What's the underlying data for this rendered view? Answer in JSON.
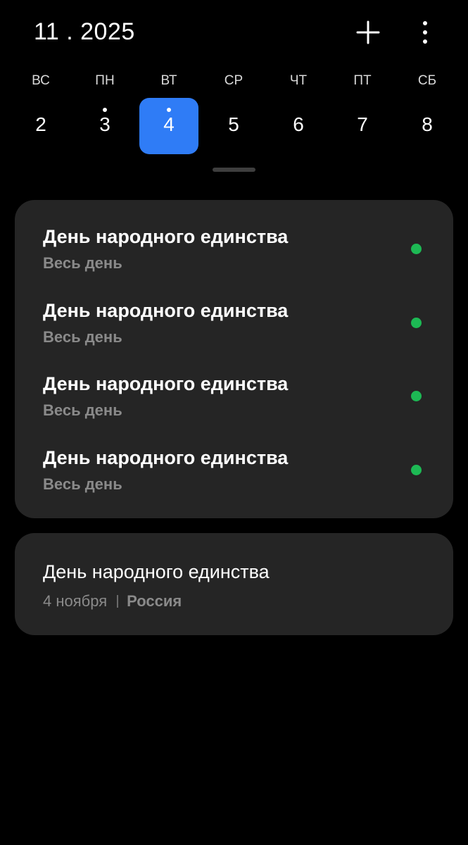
{
  "header": {
    "month_title": "11 . 2025",
    "add_icon": "plus-icon",
    "more_icon": "more-vertical-icon"
  },
  "week": {
    "days": [
      {
        "dow": "ВС",
        "date": "2",
        "has_event": false,
        "selected": false
      },
      {
        "dow": "ПН",
        "date": "3",
        "has_event": true,
        "selected": false
      },
      {
        "dow": "ВТ",
        "date": "4",
        "has_event": true,
        "selected": true
      },
      {
        "dow": "СР",
        "date": "5",
        "has_event": false,
        "selected": false
      },
      {
        "dow": "ЧТ",
        "date": "6",
        "has_event": false,
        "selected": false
      },
      {
        "dow": "ПТ",
        "date": "7",
        "has_event": false,
        "selected": false
      },
      {
        "dow": "СБ",
        "date": "8",
        "has_event": false,
        "selected": false
      }
    ]
  },
  "events": [
    {
      "title": "День народного единства",
      "subtitle": "Весь день",
      "color": "#1db954"
    },
    {
      "title": "День народного единства",
      "subtitle": "Весь день",
      "color": "#1db954"
    },
    {
      "title": "День народного единства",
      "subtitle": "Весь день",
      "color": "#1db954"
    },
    {
      "title": "День народного единства",
      "subtitle": "Весь день",
      "color": "#1db954"
    }
  ],
  "holiday": {
    "title": "День народного единства",
    "date": "4 ноября",
    "country": "Россия"
  },
  "colors": {
    "accent": "#2f7cf6",
    "background": "#000000",
    "card": "#252525",
    "event_dot": "#1db954"
  }
}
